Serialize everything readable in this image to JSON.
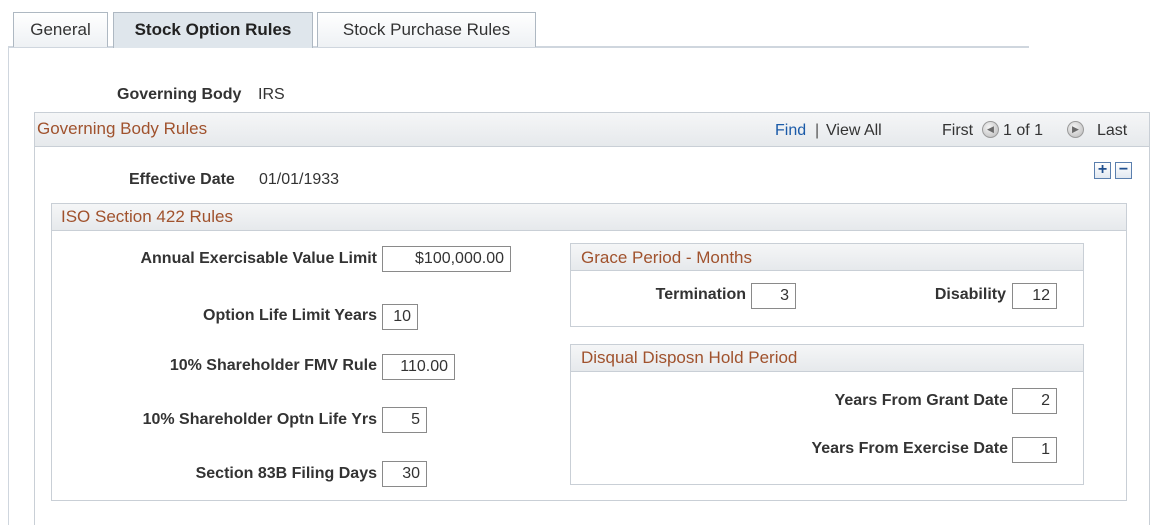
{
  "tabs": [
    {
      "label": "General",
      "active": false
    },
    {
      "label": "Stock Option Rules",
      "active": true
    },
    {
      "label": "Stock Purchase Rules",
      "active": false
    }
  ],
  "governing_body": {
    "label": "Governing Body",
    "value": "IRS"
  },
  "rules_grid": {
    "title": "Governing Body Rules",
    "find_link": "Find",
    "separator": "|",
    "view_all_link": "View All",
    "first_label": "First",
    "page_status": "1 of 1",
    "last_label": "Last",
    "add_label": "+",
    "delete_label": "−"
  },
  "effective_date": {
    "label": "Effective Date",
    "value": "01/01/1933"
  },
  "iso_section": {
    "title": "ISO Section 422 Rules",
    "fields": {
      "annual_limit": {
        "label": "Annual Exercisable Value Limit",
        "value": "$100,000.00"
      },
      "option_life": {
        "label": "Option Life Limit Years",
        "value": "10"
      },
      "fmv_rule": {
        "label": "10% Shareholder FMV Rule",
        "value": "110.00"
      },
      "optn_life_yrs": {
        "label": "10% Shareholder Optn Life Yrs",
        "value": "5"
      },
      "filing_days": {
        "label": "Section 83B Filing Days",
        "value": "30"
      }
    }
  },
  "grace_period": {
    "title": "Grace Period - Months",
    "termination": {
      "label": "Termination",
      "value": "3"
    },
    "disability": {
      "label": "Disability",
      "value": "12"
    }
  },
  "disqual": {
    "title": "Disqual Disposn Hold Period",
    "grant": {
      "label": "Years From Grant Date",
      "value": "2"
    },
    "exercise": {
      "label": "Years From Exercise Date",
      "value": "1"
    }
  }
}
